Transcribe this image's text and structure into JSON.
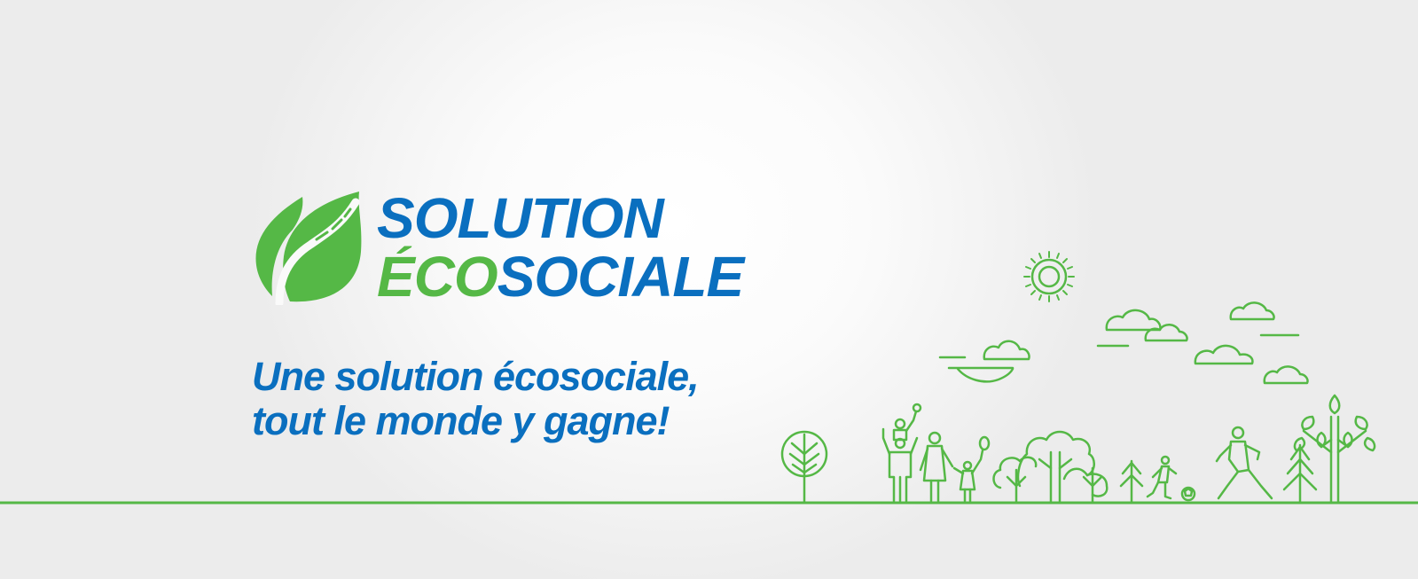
{
  "logo": {
    "line1": "SOLUTION",
    "line2_green": "ÉCO",
    "line2_blue": "SOCIALE",
    "leaf_icon": "leaf-road-icon"
  },
  "tagline": {
    "line1": "Une solution écosociale,",
    "line2": "tout le monde y gagne!"
  },
  "colors": {
    "brand_blue": "#0a6fbf",
    "brand_green": "#55b846",
    "background": "#ececec"
  },
  "illustration": {
    "icons": [
      "sun-icon",
      "cloud-icon",
      "tree-icon",
      "family-icon",
      "child-with-balloon-icon",
      "soccer-player-icon",
      "soccer-ball-icon",
      "running-man-icon",
      "pine-tree-icon",
      "ground-line"
    ]
  }
}
